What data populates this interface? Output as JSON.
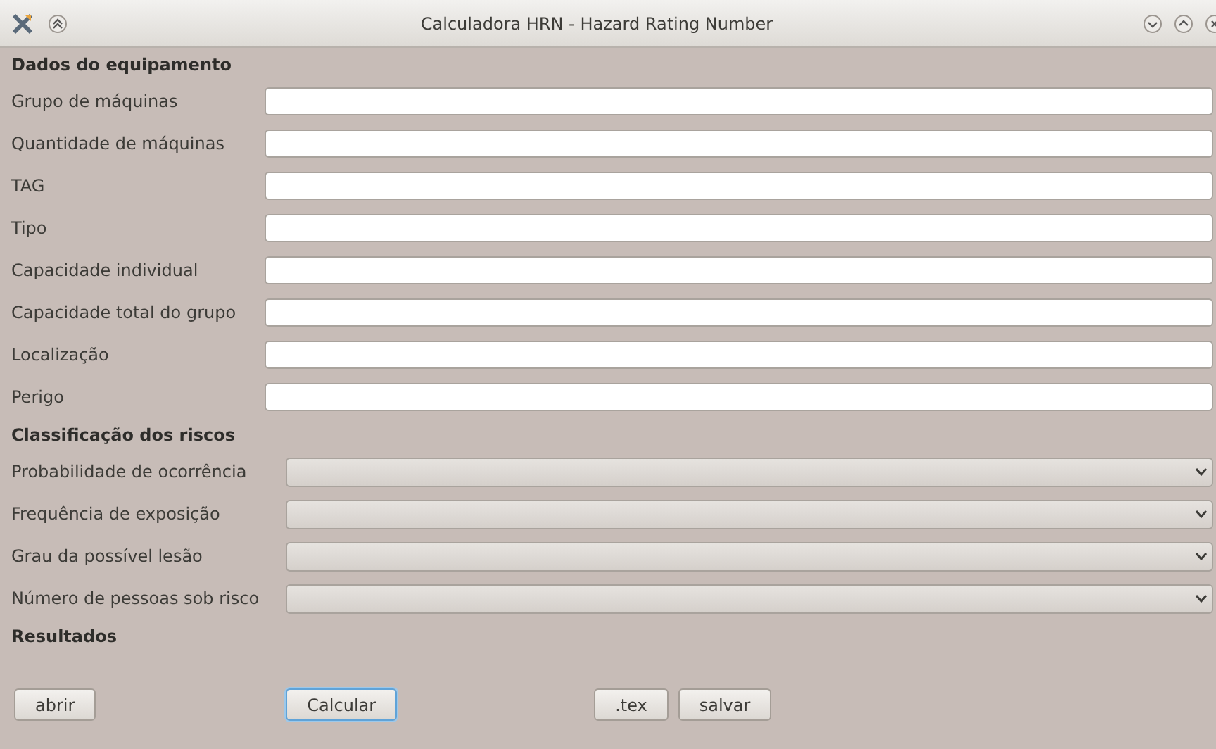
{
  "window": {
    "title": "Calculadora HRN - Hazard Rating Number"
  },
  "sections": [
    {
      "title": "Dados do equipamento",
      "fields": [
        {
          "label": "Grupo de máquinas",
          "kind": "text"
        },
        {
          "label": "Quantidade de máquinas",
          "kind": "text"
        },
        {
          "label": "TAG",
          "kind": "text"
        },
        {
          "label": "Tipo",
          "kind": "text"
        },
        {
          "label": "Capacidade individual",
          "kind": "text"
        },
        {
          "label": "Capacidade total do grupo",
          "kind": "text"
        },
        {
          "label": "Localização",
          "kind": "text"
        },
        {
          "label": "Perigo",
          "kind": "text"
        }
      ]
    },
    {
      "title": "Classificação dos riscos",
      "fields": [
        {
          "label": "Probabilidade de ocorrência",
          "kind": "dropdown"
        },
        {
          "label": "Frequência de exposição",
          "kind": "dropdown"
        },
        {
          "label": "Grau da possível lesão",
          "kind": "dropdown"
        },
        {
          "label": "Número de pessoas sob risco",
          "kind": "dropdown"
        }
      ]
    },
    {
      "title": "Resultados"
    }
  ],
  "buttons": [
    {
      "label": "abrir",
      "focused": false
    },
    {
      "label": "Calcular",
      "focused": true
    },
    {
      "label": ".tex",
      "focused": false
    },
    {
      "label": "salvar",
      "focused": false
    }
  ]
}
